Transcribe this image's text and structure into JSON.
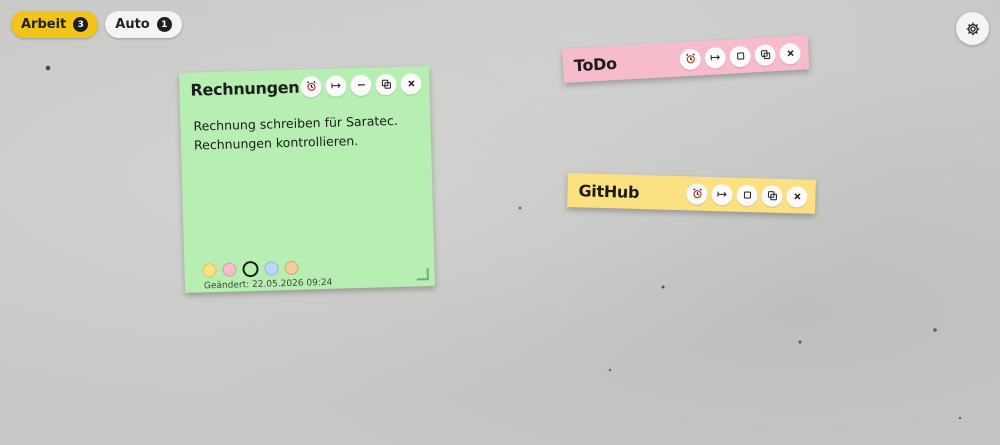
{
  "tabs": [
    {
      "label": "Arbeit",
      "count": "3",
      "active": true
    },
    {
      "label": "Auto",
      "count": "1",
      "active": false
    }
  ],
  "settings": {
    "icon": "gear-icon"
  },
  "notes": [
    {
      "title": "Rechnungen",
      "color": "#b6efb1",
      "lines": [
        "Rechnung schreiben für Saratec.",
        "Rechnungen kontrollieren."
      ],
      "changed": "Geändert: 22.05.2026 09:24",
      "swatches": [
        "#fbe182",
        "#f7bccc",
        "#b6efb1",
        "#bcd8f7",
        "#f7c9a0"
      ]
    },
    {
      "title": "ToDo",
      "color": "#f7bccc"
    },
    {
      "title": "GitHub",
      "color": "#fbe182"
    }
  ]
}
